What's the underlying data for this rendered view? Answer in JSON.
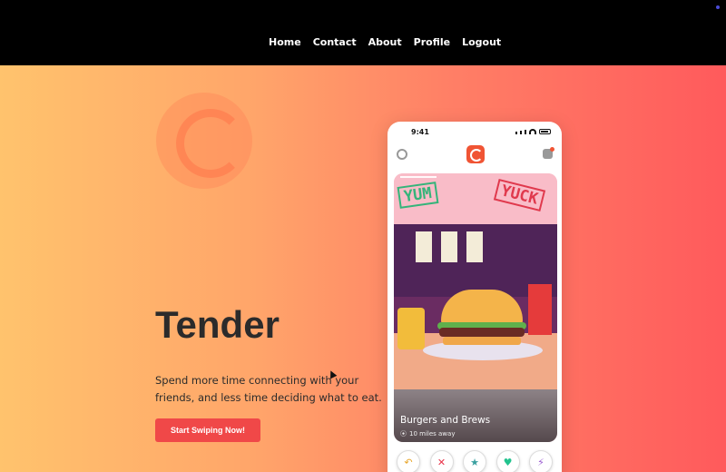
{
  "nav": {
    "items": [
      "Home",
      "Contact",
      "About",
      "Profile",
      "Logout"
    ]
  },
  "hero": {
    "title": "Tender",
    "tagline": "Spend more time connecting with your friends, and less time deciding what to eat.",
    "cta_label": "Start Swiping Now!"
  },
  "phone": {
    "time": "9:41",
    "stamps": {
      "yum": "YUM",
      "yuck": "YUCK"
    },
    "card": {
      "name": "Burgers and Brews",
      "distance": "10 miles away"
    }
  },
  "colors": {
    "nav_bg": "#000000",
    "gradient_left": "#ffc36d",
    "gradient_right": "#ff5a5c",
    "cta_bg": "#f04848",
    "yum": "#35b47a",
    "yuck": "#e0394d"
  },
  "icons": [
    "rewind-icon",
    "nope-icon",
    "star-icon",
    "like-icon",
    "boost-icon"
  ]
}
